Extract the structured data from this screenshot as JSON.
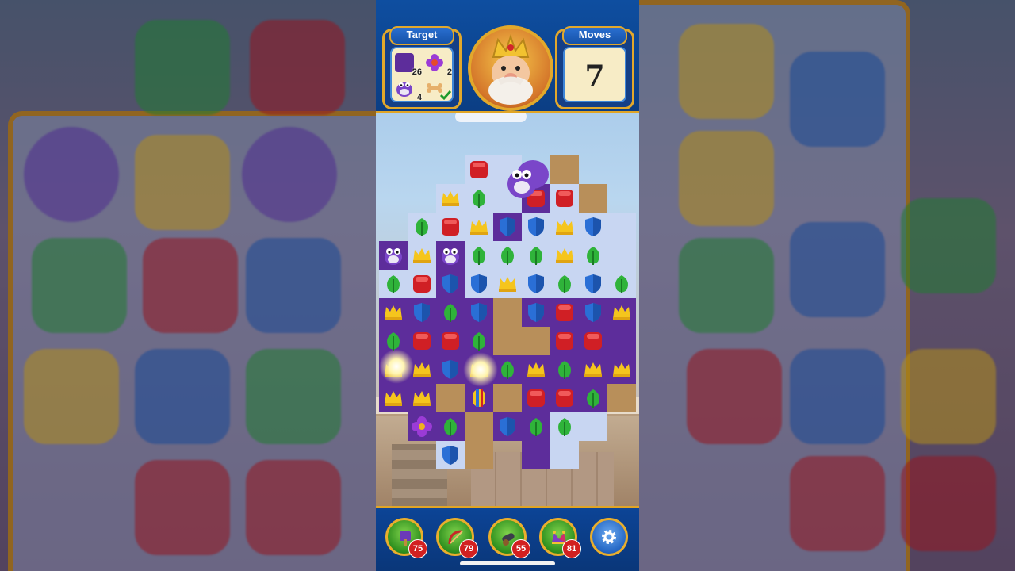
{
  "hud": {
    "target_label": "Target",
    "moves_label": "Moves",
    "moves_value": "7",
    "goals": [
      {
        "icon": "purple-floor-tile-icon",
        "count": "26"
      },
      {
        "icon": "purple-flower-icon",
        "count": "2"
      },
      {
        "icon": "purple-frog-icon",
        "count": "4"
      },
      {
        "icon": "bone-icon",
        "count": "",
        "completed": true
      }
    ]
  },
  "boosters": [
    {
      "icon": "purple-box-hammer-icon",
      "count": "75"
    },
    {
      "icon": "red-bow-arrow-icon",
      "count": "79"
    },
    {
      "icon": "cannon-icon",
      "count": "55"
    },
    {
      "icon": "jester-hat-icon",
      "count": "81"
    }
  ],
  "settings": {
    "icon": "gear-icon"
  },
  "colors": {
    "hud_blue": "#0e4ea0",
    "gold_border": "#e2a82b",
    "cell_light": "#c8d6f2",
    "cell_purple": "#5d2d9b",
    "badge_red": "#d22020"
  },
  "gem_legend": {
    "R": "red-block",
    "G": "green-leaf",
    "B": "blue-shield",
    "Y": "yellow-crown",
    "F": "purple-frog",
    "P": "purple-flower",
    "S": "striped-rocket",
    "K": "purple-pot"
  },
  "board_rows": [
    "...R?..",
    "..YG?RR.",
    ".GRYBBYB",
    "FYFGGGYG",
    "GRBBYBGBG",
    "YBGB.BRBY",
    "GRRG..RR",
    "YYBYGYGYY",
    "YY.S.RRG.",
    ".PG.BGG",
    "..B.K"
  ],
  "board_grid": [
    "...XX X.",
    "..XXXXXX",
    ".XXXXXXXX",
    "XXXXXXXXX",
    "XXXXXXXXX",
    "XXXXXXXXX",
    "XXXXXXXXX",
    "XXXXXXXXX",
    "XXXXXXXXX",
    ".XXXXXXX.",
    "..XX.XX.."
  ]
}
